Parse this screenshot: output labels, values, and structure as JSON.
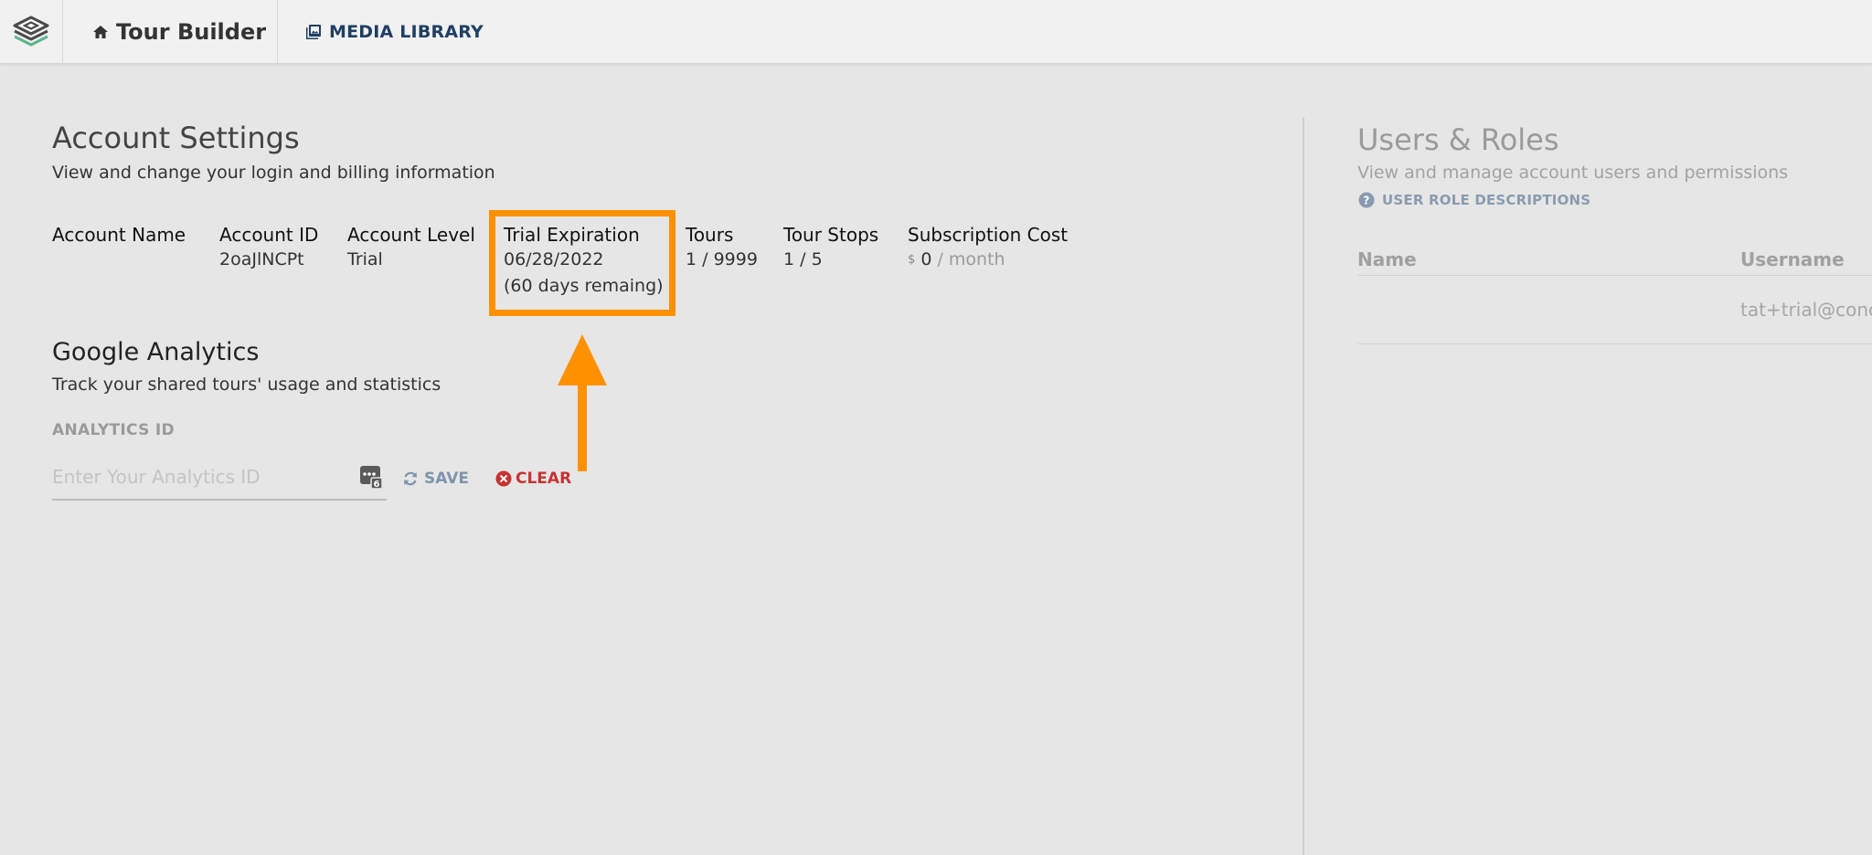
{
  "nav": {
    "tour_builder": "Tour Builder",
    "media_library": "MEDIA LIBRARY"
  },
  "account": {
    "title": "Account Settings",
    "subtitle": "View and change your login and billing information",
    "fields": {
      "account_name": {
        "label": "Account Name",
        "value": ""
      },
      "account_id": {
        "label": "Account ID",
        "value": "2oaJlNCPt"
      },
      "account_level": {
        "label": "Account Level",
        "value": "Trial"
      },
      "trial_expiration": {
        "label": "Trial Expiration",
        "date": "06/28/2022",
        "remaining": "(60 days remaing)"
      },
      "tours": {
        "label": "Tours",
        "value": "1 / 9999"
      },
      "tour_stops": {
        "label": "Tour Stops",
        "value": "1 / 5"
      },
      "subscription_cost": {
        "label": "Subscription Cost",
        "currency": "$",
        "amount": "0",
        "period": " / month"
      }
    }
  },
  "analytics": {
    "title": "Google Analytics",
    "subtitle": "Track your shared tours' usage and statistics",
    "id_label": "ANALYTICS ID",
    "placeholder": "Enter Your Analytics ID",
    "save_label": "SAVE",
    "clear_label": "CLEAR"
  },
  "users": {
    "title": "Users & Roles",
    "subtitle": "View and manage account users and permissions",
    "role_link": "USER ROLE DESCRIPTIONS",
    "columns": [
      "Name",
      "Username"
    ],
    "rows": [
      {
        "name": "",
        "username": "tat+trial@conce"
      }
    ]
  },
  "colors": {
    "highlight": "#ff9100",
    "nav_media": "#1f3f63",
    "clear": "#c83232",
    "save": "#7f93ad"
  }
}
